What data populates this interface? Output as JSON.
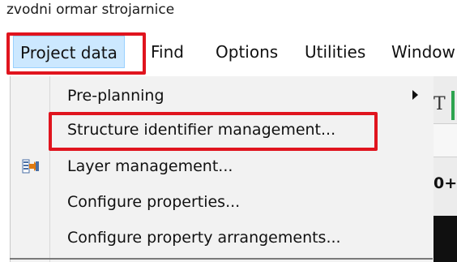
{
  "window": {
    "title_fragment": "zvodni ormar strojarnice"
  },
  "menubar": {
    "items": [
      "Project data",
      "Find",
      "Options",
      "Utilities",
      "Window"
    ]
  },
  "dropdown": {
    "items": [
      {
        "label": "Pre-planning",
        "has_submenu": true,
        "icon": null
      },
      {
        "label": "Structure identifier management...",
        "has_submenu": false,
        "icon": null
      },
      {
        "label": "Layer management...",
        "has_submenu": false,
        "icon": "layer-icon"
      },
      {
        "label": "Configure properties...",
        "has_submenu": false,
        "icon": null
      },
      {
        "label": "Configure property arrangements...",
        "has_submenu": false,
        "icon": null
      }
    ]
  },
  "background": {
    "toolbar_glyph": "T",
    "value_fragment": "0+"
  },
  "colors": {
    "highlight_red": "#e0141e",
    "menu_active_bg": "#cce8ff",
    "dropdown_bg": "#f2f2f2"
  }
}
